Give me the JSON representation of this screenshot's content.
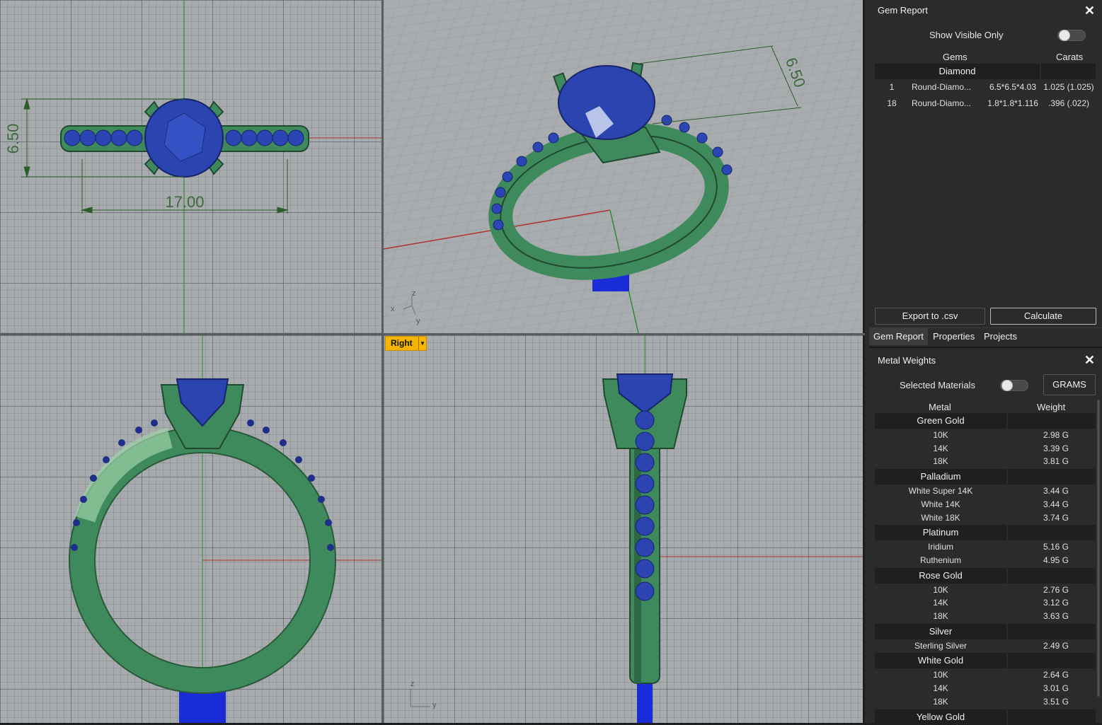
{
  "viewports": {
    "top": {
      "dim_height": "6.50",
      "dim_width": "17.00"
    },
    "perspective": {
      "dim_height": "6.50",
      "axis_x": "x",
      "axis_y": "y",
      "axis_z": "z"
    },
    "right": {
      "label": "Right",
      "axis_z": "z",
      "axis_y": "y"
    }
  },
  "gem_report": {
    "title": "Gem Report",
    "show_visible_only_label": "Show Visible Only",
    "col_gems": "Gems",
    "col_carats": "Carats",
    "group": "Diamond",
    "rows": [
      {
        "qty": "1",
        "shape": "Round-Diamo...",
        "size": "6.5*6.5*4.03",
        "carats": "1.025 (1.025)"
      },
      {
        "qty": "18",
        "shape": "Round-Diamo...",
        "size": "1.8*1.8*1.116",
        "carats": ".396 (.022)"
      }
    ],
    "export_label": "Export to .csv",
    "calculate_label": "Calculate"
  },
  "tabs": [
    "Gem Report",
    "Properties",
    "Projects"
  ],
  "metal_weights": {
    "title": "Metal Weights",
    "selected_materials_label": "Selected Materials",
    "unit_button": "GRAMS",
    "col_metal": "Metal",
    "col_weight": "Weight",
    "groups": [
      {
        "name": "Green Gold",
        "items": [
          [
            "10K",
            "2.98 G"
          ],
          [
            "14K",
            "3.39 G"
          ],
          [
            "18K",
            "3.81 G"
          ]
        ]
      },
      {
        "name": "Palladium",
        "items": [
          [
            "White Super 14K",
            "3.44 G"
          ],
          [
            "White 14K",
            "3.44 G"
          ],
          [
            "White 18K",
            "3.74 G"
          ]
        ]
      },
      {
        "name": "Platinum",
        "items": [
          [
            "Iridium",
            "5.16 G"
          ],
          [
            "Ruthenium",
            "4.95 G"
          ]
        ]
      },
      {
        "name": "Rose Gold",
        "items": [
          [
            "10K",
            "2.76 G"
          ],
          [
            "14K",
            "3.12 G"
          ],
          [
            "18K",
            "3.63 G"
          ]
        ]
      },
      {
        "name": "Silver",
        "items": [
          [
            "Sterling Silver",
            "2.49 G"
          ]
        ]
      },
      {
        "name": "White Gold",
        "items": [
          [
            "10K",
            "2.64 G"
          ],
          [
            "14K",
            "3.01 G"
          ],
          [
            "18K",
            "3.51 G"
          ]
        ]
      },
      {
        "name": "Yellow Gold",
        "items": []
      }
    ]
  },
  "colors": {
    "metal": "#3f8a5c",
    "gem": "#2a3fb0",
    "viewport_bg": "#a8abad",
    "active_label": "#f5b400",
    "panel_bg": "#2b2b2b"
  },
  "icons": [
    "close-icon",
    "dropdown-arrow-icon"
  ]
}
